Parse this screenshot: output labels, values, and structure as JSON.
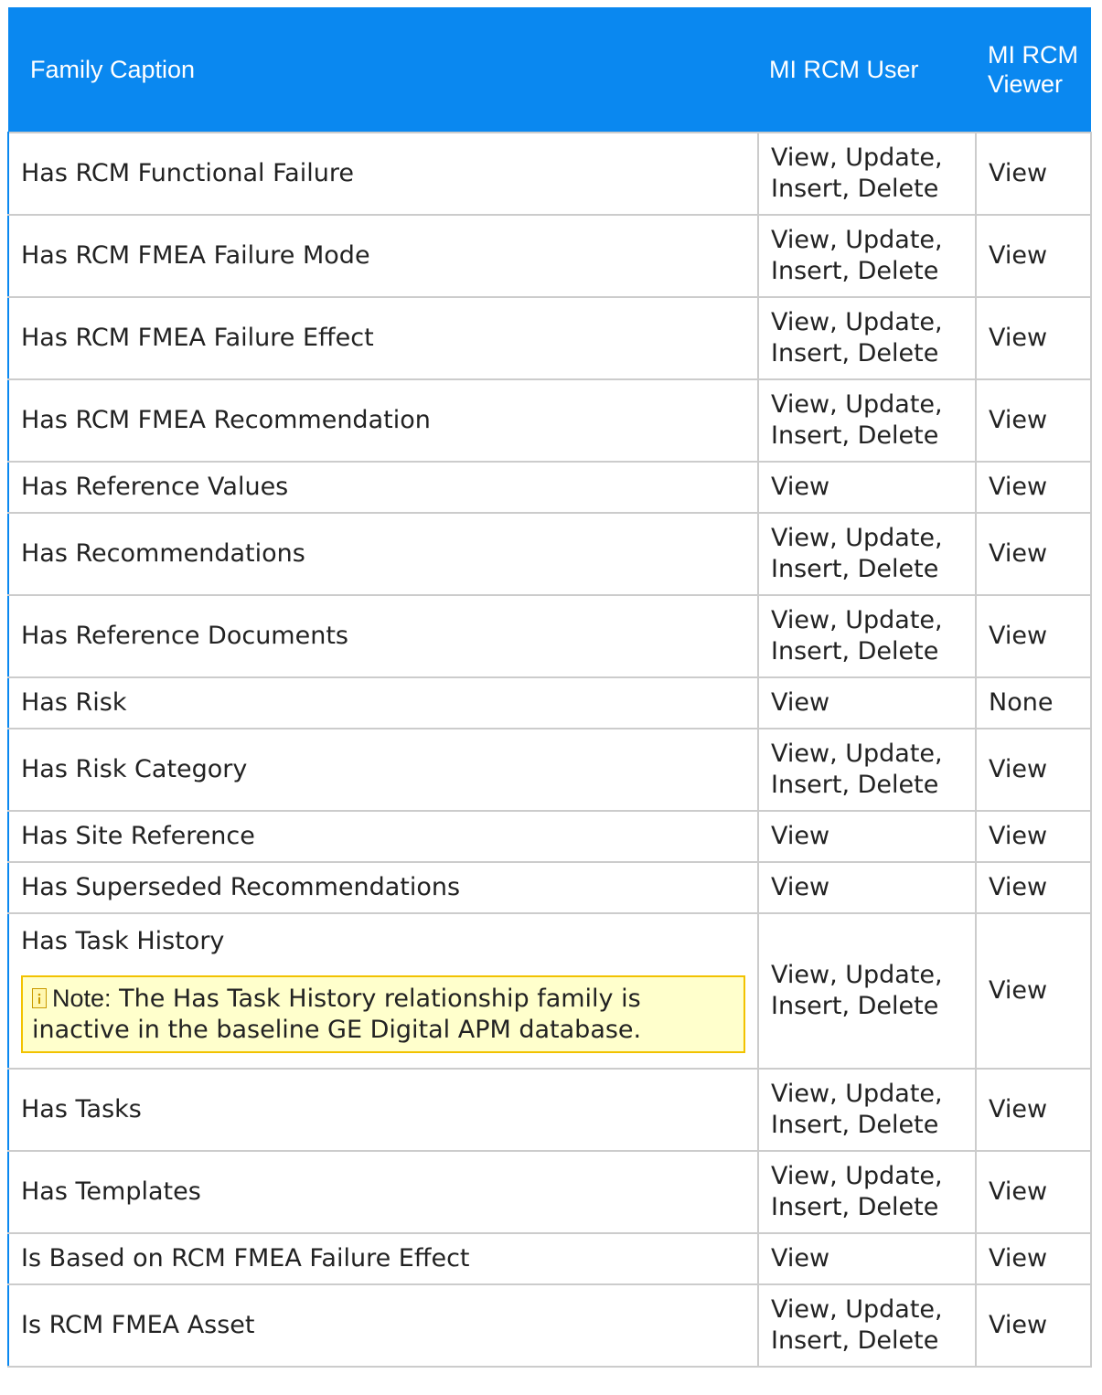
{
  "table": {
    "headers": [
      "Family Caption",
      "MI RCM User",
      "MI RCM Viewer"
    ],
    "rows": [
      {
        "caption": "Has RCM Functional Failure",
        "user": "View, Update, Insert, Delete",
        "viewer": "View"
      },
      {
        "caption": "Has RCM FMEA Failure Mode",
        "user": "View, Update, Insert, Delete",
        "viewer": "View"
      },
      {
        "caption": "Has RCM FMEA Failure Effect",
        "user": "View, Update, Insert, Delete",
        "viewer": "View"
      },
      {
        "caption": "Has RCM FMEA Recommendation",
        "user": "View, Update, Insert, Delete",
        "viewer": "View"
      },
      {
        "caption": "Has Reference Values",
        "user": "View",
        "viewer": "View"
      },
      {
        "caption": "Has Recommendations",
        "user": "View, Update, Insert, Delete",
        "viewer": "View"
      },
      {
        "caption": "Has Reference Documents",
        "user": "View, Update, Insert, Delete",
        "viewer": "View"
      },
      {
        "caption": "Has Risk",
        "user": "View",
        "viewer": "None"
      },
      {
        "caption": "Has Risk Category",
        "user": "View, Update, Insert, Delete",
        "viewer": "View"
      },
      {
        "caption": "Has Site Reference",
        "user": "View",
        "viewer": "View"
      },
      {
        "caption": "Has Superseded Recommendations",
        "user": "View",
        "viewer": "View"
      },
      {
        "caption": "Has Task History",
        "user": "View, Update, Insert, Delete",
        "viewer": "View",
        "note_label": "Note:",
        "note_text": " The Has Task History relationship family is inactive in the baseline GE Digital APM database."
      },
      {
        "caption": "Has Tasks",
        "user": "View, Update, Insert, Delete",
        "viewer": "View"
      },
      {
        "caption": "Has Templates",
        "user": "View, Update, Insert, Delete",
        "viewer": "View"
      },
      {
        "caption": "Is Based on RCM FMEA Failure Effect",
        "user": "View",
        "viewer": "View"
      },
      {
        "caption": "Is RCM FMEA Asset",
        "user": "View, Update, Insert, Delete",
        "viewer": "View"
      }
    ]
  },
  "colors": {
    "header_bg": "#0a88f0",
    "border": "#cccccc",
    "note_bg": "#ffffcc",
    "note_border": "#f2c200"
  },
  "icons": {
    "note": "note-info-icon"
  }
}
